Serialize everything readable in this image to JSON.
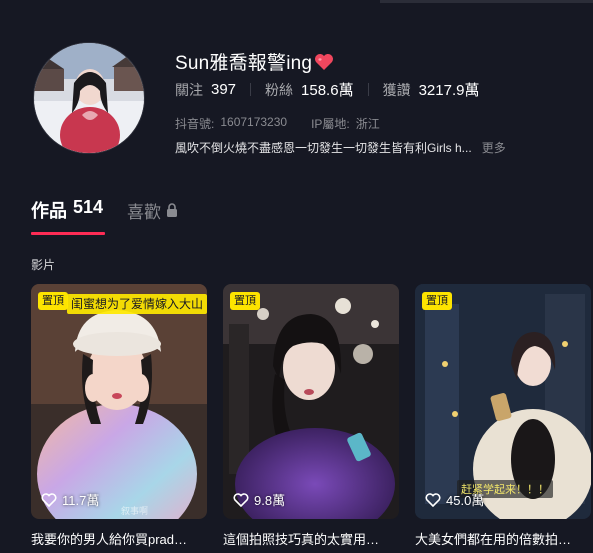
{
  "profile": {
    "name": "Sun雅喬報警ing",
    "name_emoji": "heart-emoji",
    "stats": [
      {
        "label": "關注",
        "value": "397"
      },
      {
        "label": "粉絲",
        "value": "158.6萬"
      },
      {
        "label": "獲讚",
        "value": "3217.9萬"
      }
    ],
    "douyin_id_label": "抖音號:",
    "douyin_id": "1607173230",
    "ip_label": "IP屬地:",
    "ip_location": "浙江",
    "bio": "風吹不倒火燒不盡感恩一切發生一切發生皆有利Girls h...",
    "more_label": "更多"
  },
  "tabs": {
    "works_label": "作品",
    "works_count": "514",
    "likes_label": "喜歡"
  },
  "section_label": "影片",
  "videos": [
    {
      "pinned_label": "置頂",
      "overlay_text": "闺蜜想为了爱情嫁入大山",
      "likes": "11.7萬",
      "watermark": "叙事啊",
      "title": "我要你的男人給你買prad…"
    },
    {
      "pinned_label": "置頂",
      "likes": "9.8萬",
      "title": "這個拍照技巧真的太實用…"
    },
    {
      "pinned_label": "置頂",
      "sticker_text": "赶紧学起来！！！",
      "likes": "45.0萬",
      "title": "大美女們都在用的倍數拍…"
    }
  ],
  "colors": {
    "background": "#161823",
    "accent": "#fe2c55",
    "pin_badge": "#fde400",
    "muted_text": "#8a8b91"
  }
}
